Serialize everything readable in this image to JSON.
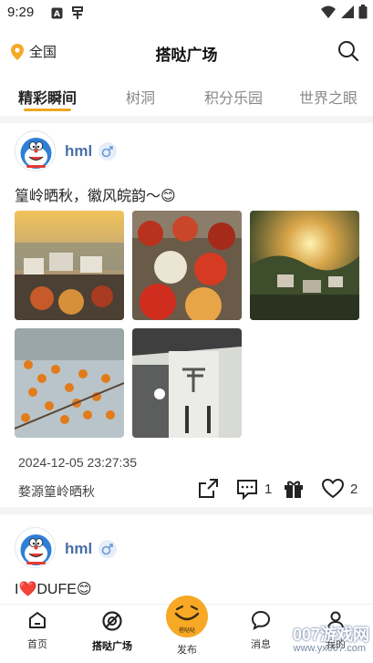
{
  "status_bar": {
    "time": "9:29"
  },
  "header": {
    "location": "全国",
    "title": "搭哒广场"
  },
  "tabs": [
    "精彩瞬间",
    "树洞",
    "积分乐园",
    "世界之眼"
  ],
  "posts": [
    {
      "username": "hml",
      "gender": "♂",
      "text": "篁岭晒秋，徽风皖韵～😊",
      "time": "2024-12-05 23:27:35",
      "tag": "婺源篁岭晒秋",
      "comments": "1",
      "likes": "2",
      "photos": [
        "village-terrace-photo",
        "drying-chili-photo",
        "sunset-village-photo",
        "persimmon-tree-photo",
        "huangling-gate-photo"
      ]
    },
    {
      "username": "hml",
      "gender": "♂",
      "text": "I❤️DUFE😊"
    }
  ],
  "bottom_nav": {
    "home": "首页",
    "plaza": "搭哒广场",
    "publish": "发布",
    "messages": "消息",
    "mine": "我的",
    "publish_badge": "搭哒哒"
  },
  "watermark": {
    "brand": "007游戏网",
    "url": "www.yx007.com"
  },
  "colors": {
    "accent": "#f7a825",
    "username": "#4a6fa5"
  }
}
